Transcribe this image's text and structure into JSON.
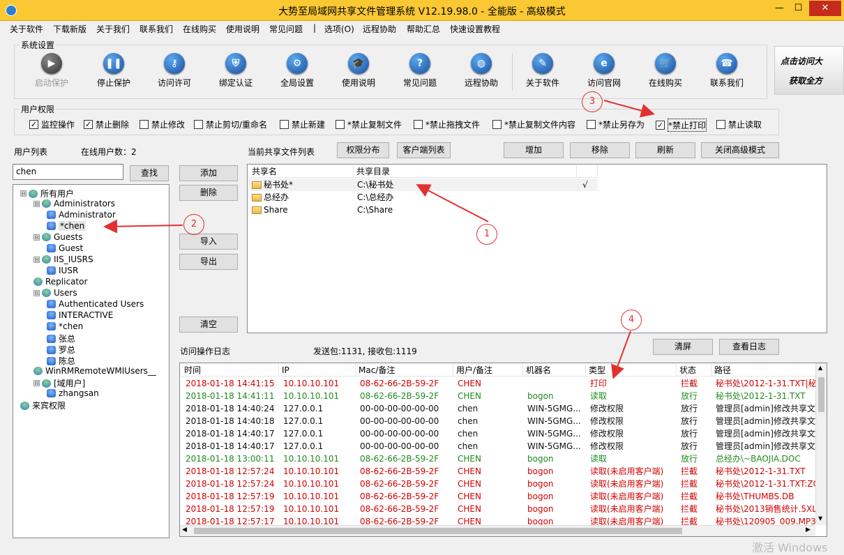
{
  "window": {
    "title": "大势至局域网共享文件管理系统 V12.19.98.0 - 全能版 - 高级模式",
    "minimize": "—",
    "maximize": "☐",
    "close": "✕"
  },
  "menu": [
    "关于软件",
    "下载新版",
    "关于我们",
    "联系我们",
    "在线购买",
    "使用说明",
    "常见问题",
    "|",
    "选项(O)",
    "远程协助",
    "帮助汇总",
    "快速设置教程"
  ],
  "system_settings": {
    "label": "系统设置",
    "buttons": [
      {
        "label": "启动保护",
        "icon": "play-icon",
        "glyph": "▶",
        "disabled": true
      },
      {
        "label": "停止保护",
        "icon": "pause-icon",
        "glyph": "❚❚",
        "disabled": false
      },
      {
        "label": "访问许可",
        "icon": "key-icon",
        "glyph": "⚷",
        "disabled": false
      },
      {
        "label": "绑定认证",
        "icon": "shield-icon",
        "glyph": "⛨",
        "disabled": false
      },
      {
        "label": "全局设置",
        "icon": "gear-icon",
        "glyph": "⚙",
        "disabled": false
      },
      {
        "label": "使用说明",
        "icon": "graduation-cap-icon",
        "glyph": "🎓",
        "disabled": false
      },
      {
        "label": "常见问题",
        "icon": "question-icon",
        "glyph": "?",
        "disabled": false
      },
      {
        "label": "远程协助",
        "icon": "globe-icon",
        "glyph": "◍",
        "disabled": false
      },
      {
        "label": "关于软件",
        "icon": "document-icon",
        "glyph": "✎",
        "disabled": false
      },
      {
        "label": "访问官网",
        "icon": "ie-icon",
        "glyph": "e",
        "disabled": false
      },
      {
        "label": "在线购买",
        "icon": "cart-icon",
        "glyph": "🛒",
        "disabled": false
      },
      {
        "label": "联系我们",
        "icon": "phone-icon",
        "glyph": "☎",
        "disabled": false
      }
    ],
    "banner_text": [
      "点击访问大",
      "获取全方"
    ]
  },
  "user_permissions": {
    "label": "用户权限",
    "checks": [
      {
        "label": "监控操作",
        "checked": true
      },
      {
        "label": "禁止删除",
        "checked": true
      },
      {
        "label": "禁止修改",
        "checked": false
      },
      {
        "label": "禁止剪切/重命名",
        "checked": false
      },
      {
        "label": "禁止新建",
        "checked": false
      },
      {
        "label": "*禁止复制文件",
        "checked": false
      },
      {
        "label": "*禁止拖拽文件",
        "checked": false
      },
      {
        "label": "*禁止复制文件内容",
        "checked": false
      },
      {
        "label": "*禁止另存为",
        "checked": false
      },
      {
        "label": "*禁止打印",
        "checked": true
      },
      {
        "label": "禁止读取",
        "checked": false
      }
    ]
  },
  "user_list": {
    "label": "用户列表",
    "online_label": "在线用户数：2",
    "search_value": "chen",
    "find_btn": "查找",
    "tree": [
      {
        "label": "所有用户",
        "level": 0,
        "kind": "group",
        "exp": "⊟"
      },
      {
        "label": "Administrators",
        "level": 1,
        "kind": "group",
        "exp": "⊟"
      },
      {
        "label": "Administrator",
        "level": 2,
        "kind": "user"
      },
      {
        "label": "*chen",
        "level": 2,
        "kind": "user",
        "selected": true
      },
      {
        "label": "Guests",
        "level": 1,
        "kind": "group",
        "exp": "⊟"
      },
      {
        "label": "Guest",
        "level": 2,
        "kind": "user"
      },
      {
        "label": "IIS_IUSRS",
        "level": 1,
        "kind": "group",
        "exp": "⊟"
      },
      {
        "label": "IUSR",
        "level": 2,
        "kind": "user"
      },
      {
        "label": "Replicator",
        "level": 1,
        "kind": "group"
      },
      {
        "label": "Users",
        "level": 1,
        "kind": "group",
        "exp": "⊟"
      },
      {
        "label": "Authenticated Users",
        "level": 2,
        "kind": "user"
      },
      {
        "label": "INTERACTIVE",
        "level": 2,
        "kind": "user"
      },
      {
        "label": "*chen",
        "level": 2,
        "kind": "user"
      },
      {
        "label": "张总",
        "level": 2,
        "kind": "user"
      },
      {
        "label": "罗总",
        "level": 2,
        "kind": "user"
      },
      {
        "label": "陈总",
        "level": 2,
        "kind": "user"
      },
      {
        "label": "WinRMRemoteWMIUsers__",
        "level": 1,
        "kind": "group"
      },
      {
        "label": "[域用户]",
        "level": 1,
        "kind": "group",
        "exp": "⊟"
      },
      {
        "label": "zhangsan",
        "level": 2,
        "kind": "user"
      },
      {
        "label": "来宾权限",
        "level": 0,
        "kind": "group"
      }
    ]
  },
  "side_buttons": {
    "add": "添加",
    "delete": "删除",
    "import": "导入",
    "export": "导出",
    "clear": "清空"
  },
  "share_list": {
    "label": "当前共享文件列表",
    "tab_perm": "权限分布",
    "tab_client": "客户端列表",
    "btn_add": "增加",
    "btn_remove": "移除",
    "btn_refresh": "刷新",
    "btn_close_adv": "关闭高级模式",
    "columns": [
      "共享名",
      "共享目录"
    ],
    "rows": [
      {
        "name": "秘书处*",
        "dir": "C:\\秘书处",
        "mark": "√"
      },
      {
        "name": "总经办",
        "dir": "C:\\总经办",
        "mark": ""
      },
      {
        "name": "Share",
        "dir": "C:\\Share",
        "mark": ""
      }
    ]
  },
  "log": {
    "label": "访问操作日志",
    "packets": "发送包:1131, 接收包:1119",
    "btn_clear": "清屏",
    "btn_view": "查看日志",
    "columns": [
      "时间",
      "IP",
      "Mac/备注",
      "用户/备注",
      "机器名",
      "类型",
      "状态",
      "路径"
    ],
    "rows": [
      {
        "c": "red",
        "v": [
          "2018-01-18 14:41:15",
          "10.10.10.101",
          "08-62-66-2B-59-2F",
          "CHEN",
          "",
          "打印",
          "拦截",
          "秘书处\\2012-1-31.TXT|秘"
        ]
      },
      {
        "c": "green",
        "v": [
          "2018-01-18 14:41:11",
          "10.10.10.101",
          "08-62-66-2B-59-2F",
          "CHEN",
          "bogon",
          "读取",
          "放行",
          "秘书处\\2012-1-31.TXT"
        ]
      },
      {
        "c": "blk",
        "v": [
          "2018-01-18 14:40:24",
          "127.0.0.1",
          "00-00-00-00-00-00",
          "chen",
          "WIN-5GMG...",
          "修改权限",
          "放行",
          "管理员[admin]修改共享文件"
        ]
      },
      {
        "c": "blk",
        "v": [
          "2018-01-18 14:40:18",
          "127.0.0.1",
          "00-00-00-00-00-00",
          "chen",
          "WIN-5GMG...",
          "修改权限",
          "放行",
          "管理员[admin]修改共享文件"
        ]
      },
      {
        "c": "blk",
        "v": [
          "2018-01-18 14:40:17",
          "127.0.0.1",
          "00-00-00-00-00-00",
          "chen",
          "WIN-5GMG...",
          "修改权限",
          "放行",
          "管理员[admin]修改共享文件"
        ]
      },
      {
        "c": "blk",
        "v": [
          "2018-01-18 14:40:17",
          "127.0.0.1",
          "00-00-00-00-00-00",
          "chen",
          "WIN-5GMG...",
          "修改权限",
          "放行",
          "管理员[admin]修改共享文件"
        ]
      },
      {
        "c": "green",
        "v": [
          "2018-01-18 13:00:11",
          "10.10.10.101",
          "08-62-66-2B-59-2F",
          "CHEN",
          "bogon",
          "读取",
          "放行",
          "总经办\\~BAOJIA.DOC"
        ]
      },
      {
        "c": "red",
        "v": [
          "2018-01-18 12:57:24",
          "10.10.10.101",
          "08-62-66-2B-59-2F",
          "CHEN",
          "bogon",
          "读取(未启用客户端)",
          "拦截",
          "秘书处\\2012-1-31.TXT"
        ]
      },
      {
        "c": "red",
        "v": [
          "2018-01-18 12:57:24",
          "10.10.10.101",
          "08-62-66-2B-59-2F",
          "CHEN",
          "bogon",
          "读取(未启用客户端)",
          "拦截",
          "秘书处\\2012-1-31.TXT:ZO"
        ]
      },
      {
        "c": "red",
        "v": [
          "2018-01-18 12:57:19",
          "10.10.10.101",
          "08-62-66-2B-59-2F",
          "CHEN",
          "bogon",
          "读取(未启用客户端)",
          "拦截",
          "秘书处\\THUMBS.DB"
        ]
      },
      {
        "c": "red",
        "v": [
          "2018-01-18 12:57:19",
          "10.10.10.101",
          "08-62-66-2B-59-2F",
          "CHEN",
          "bogon",
          "读取(未启用客户端)",
          "拦截",
          "秘书处\\2013销售统计.5XL"
        ]
      },
      {
        "c": "red",
        "v": [
          "2018-01-18 12:57:17",
          "10.10.10.101",
          "08-62-66-2B-59-2F",
          "CHEN",
          "bogon",
          "读取(未启用客户端)",
          "拦截",
          "秘书处\\120905_009.MP3"
        ]
      }
    ]
  },
  "annotations": [
    "1",
    "2",
    "3",
    "4"
  ],
  "watermark": "激活 Windows",
  "colors": {
    "titlebar": "#fac832",
    "red_row": "#d20000",
    "green_row": "#1e8a1e",
    "annotation": "#e23030"
  }
}
